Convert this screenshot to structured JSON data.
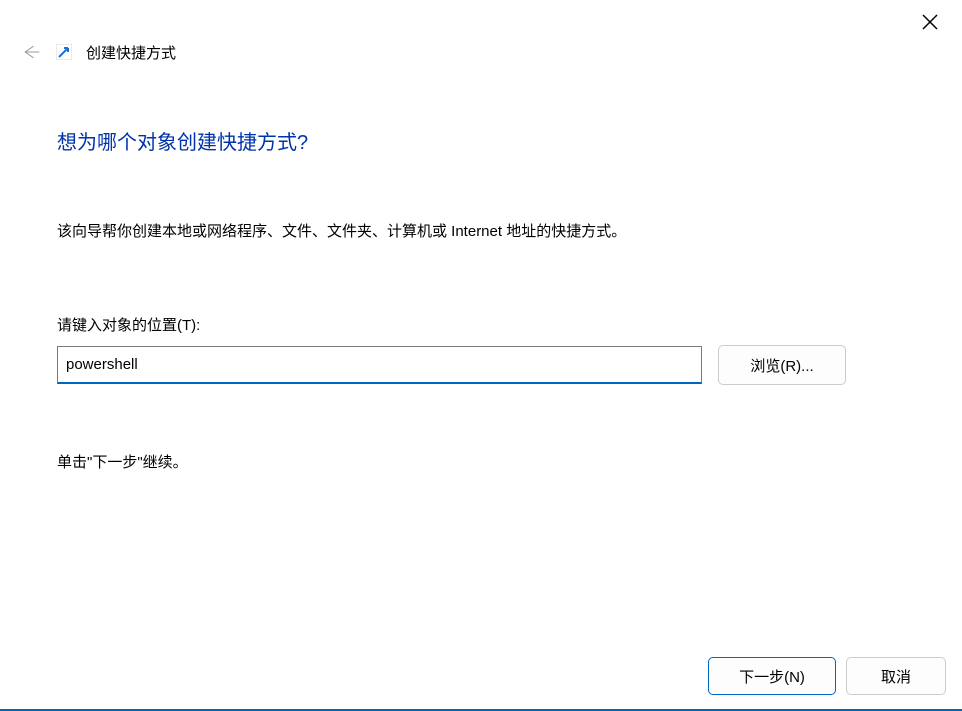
{
  "titlebar": {
    "close": "×"
  },
  "header": {
    "wizard_title": "创建快捷方式"
  },
  "content": {
    "heading": "想为哪个对象创建快捷方式?",
    "description": "该向导帮你创建本地或网络程序、文件、文件夹、计算机或 Internet 地址的快捷方式。",
    "location_label": "请键入对象的位置(T):",
    "location_value": "powershell",
    "browse_label": "浏览(R)...",
    "instruction": "单击\"下一步\"继续。"
  },
  "footer": {
    "next_label": "下一步(N)",
    "cancel_label": "取消"
  }
}
